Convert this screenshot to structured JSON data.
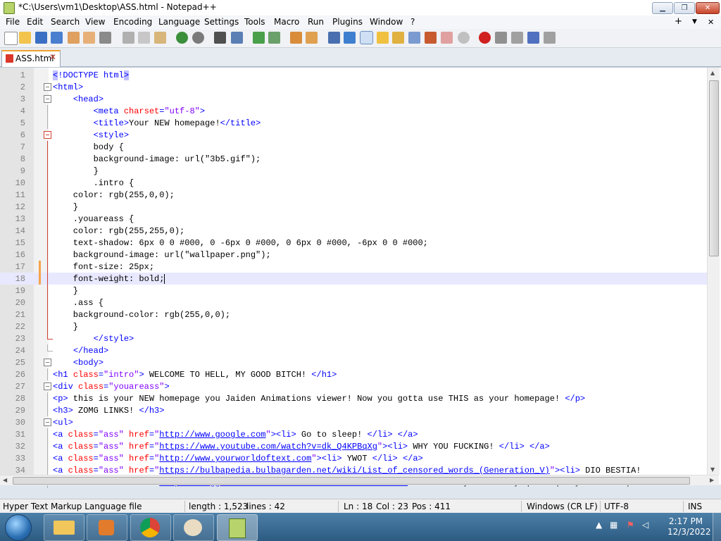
{
  "window": {
    "title": "*C:\\Users\\vm1\\Desktop\\ASS.html - Notepad++",
    "icon": "notepad-plus-plus-icon"
  },
  "menu": {
    "items": [
      "File",
      "Edit",
      "Search",
      "View",
      "Encoding",
      "Language",
      "Settings",
      "Tools",
      "Macro",
      "Run",
      "Plugins",
      "Window",
      "?"
    ],
    "right": [
      "+",
      "▼",
      "✕"
    ]
  },
  "toolbar": {
    "icons": [
      "new-file-icon",
      "open-file-icon",
      "save-icon",
      "save-all-icon",
      "close-icon",
      "close-all-icon",
      "print-icon",
      "cut-icon",
      "copy-icon",
      "paste-icon",
      "undo-icon",
      "redo-icon",
      "find-icon",
      "replace-icon",
      "zoom-in-icon",
      "zoom-out-icon",
      "sync-vertical-icon",
      "sync-horizontal-icon",
      "word-wrap-icon",
      "show-all-characters-icon",
      "indent-guide-icon",
      "user-defined-language-icon",
      "document-map-icon",
      "function-list-icon",
      "folder-as-workspace-icon",
      "document-list-icon",
      "monitoring-icon",
      "record-macro-icon",
      "stop-recording-icon",
      "playback-icon",
      "run-macro-multiple-icon",
      "save-macro-icon"
    ]
  },
  "tab": {
    "label": "ASS.html",
    "close": "✕"
  },
  "editor": {
    "current_line": 18,
    "lines": [
      "<!DOCTYPE html>",
      "<html>",
      "    <head>",
      "        <meta charset=\"utf-8\">",
      "        <title>Your NEW homepage!</title>",
      "        <style>",
      "        body {",
      "        background-image: url(\"3b5.gif\");",
      "        }",
      "        .intro {",
      "    color: rgb(255,0,0);",
      "    }",
      "    .youareass {",
      "    color: rgb(255,255,0);",
      "    text-shadow: 6px 0 0 #000, 0 -6px 0 #000, 0 6px 0 #000, -6px 0 0 #000;",
      "    background-image: url(\"wallpaper.png\");",
      "    font-size: 25px;",
      "    font-weight: bold;",
      "    }",
      "    .ass {",
      "    background-color: rgb(255,0,0);",
      "    }",
      "        </style>",
      "    </head>",
      "    <body>",
      "<h1 class=\"intro\"> WELCOME TO HELL, MY GOOD BITCH! </h1>",
      "<div class=\"youareass\">",
      "<p> this is your NEW homepage you Jaiden Animations viewer! Now you gotta use THIS as your homepage! </p>",
      "<h3> ZOMG LINKS! </h3>",
      "<ul>",
      "<a class=\"ass\" href=\"http://www.google.com\"><li> Go to sleep! </li> </a>",
      "<a class=\"ass\" href=\"https://www.youtube.com/watch?v=dk_Q4KPBqXg\"><li> WHY YOU FUCKING! </li> </a>",
      "<a class=\"ass\" href=\"http://www.yourworldoftext.com\"><li> YWOT </li> </a>",
      "<a class=\"ass\" href=\"https://bulbapedia.bulbagarden.net/wiki/List_of_censored_words_(Generation_V)\"><li> DIO BESTIA!",
      "<a class=\"ass\" href=\"https://biggie-cs-crib.fandom.com/wiki/ILR_MR_GAY\"><li> Are you Mr. Gay quiz? (Very accurate) <"
    ]
  },
  "status": {
    "file_type": "Hyper Text Markup Language file",
    "length": "length : 1,523",
    "lines": "lines : 42",
    "ln": "Ln : 18",
    "col": "Col : 23",
    "pos": "Pos : 411",
    "eol": "Windows (CR LF)",
    "encoding": "UTF-8",
    "mode": "INS"
  },
  "taskbar": {
    "apps": [
      "windows-explorer-icon",
      "media-player-icon",
      "chrome-icon",
      "paint-icon",
      "notepad-plus-plus-icon"
    ],
    "time": "2:17 PM",
    "date": "12/3/2022"
  },
  "colors": {
    "tag": "#0000ff",
    "attribute": "#ff0000",
    "value": "#8000ff",
    "current_line": "#e8e8ff",
    "gutter": "#e4e4e4"
  }
}
